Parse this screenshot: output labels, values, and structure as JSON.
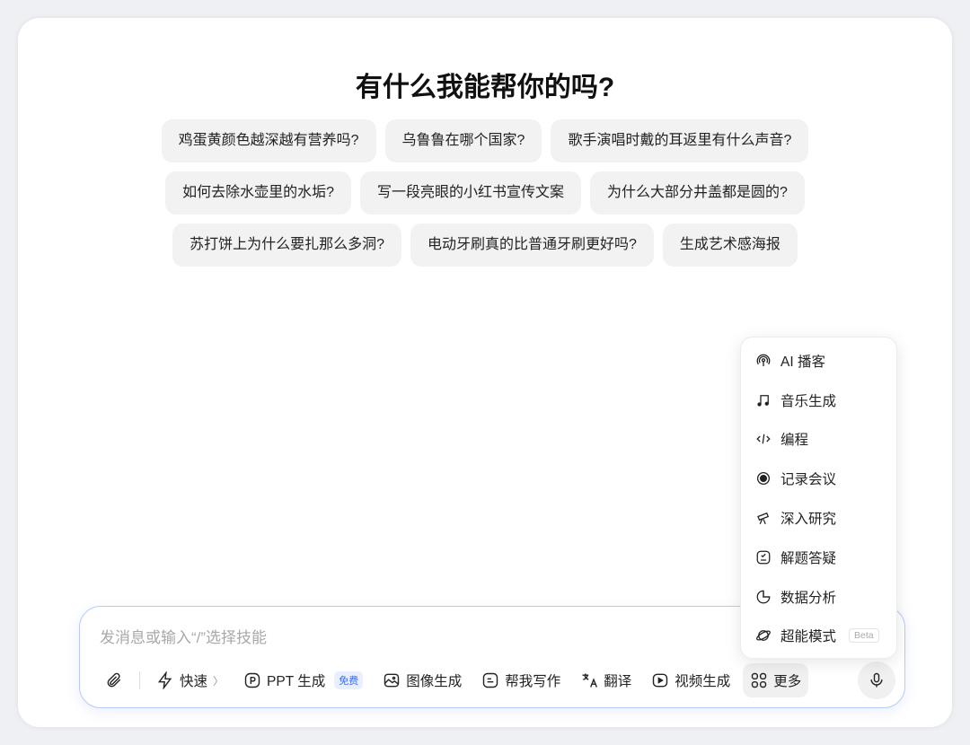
{
  "title": "有什么我能帮你的吗?",
  "suggestions": [
    [
      "鸡蛋黄颜色越深越有营养吗?",
      "乌鲁鲁在哪个国家?",
      "歌手演唱时戴的耳返里有什么声音?"
    ],
    [
      "如何去除水壶里的水垢?",
      "写一段亮眼的小红书宣传文案",
      "为什么大部分井盖都是圆的?"
    ],
    [
      "苏打饼上为什么要扎那么多洞?",
      "电动牙刷真的比普通牙刷更好吗?",
      "生成艺术感海报"
    ]
  ],
  "input": {
    "placeholder": "发消息或输入“/”选择技能"
  },
  "toolbar": {
    "quick": "快速",
    "quick_chevron": "〉",
    "ppt": "PPT 生成",
    "ppt_badge": "免费",
    "image": "图像生成",
    "write": "帮我写作",
    "translate": "翻译",
    "video": "视频生成",
    "more": "更多"
  },
  "menu": [
    {
      "label": "AI 播客",
      "icon": "podcast-icon"
    },
    {
      "label": "音乐生成",
      "icon": "music-note-icon"
    },
    {
      "label": "编程",
      "icon": "code-icon"
    },
    {
      "label": "记录会议",
      "icon": "record-icon"
    },
    {
      "label": "深入研究",
      "icon": "telescope-icon"
    },
    {
      "label": "解题答疑",
      "icon": "check-box-icon"
    },
    {
      "label": "数据分析",
      "icon": "pie-chart-icon"
    },
    {
      "label": "超能模式",
      "icon": "planet-icon",
      "badge": "Beta"
    }
  ]
}
